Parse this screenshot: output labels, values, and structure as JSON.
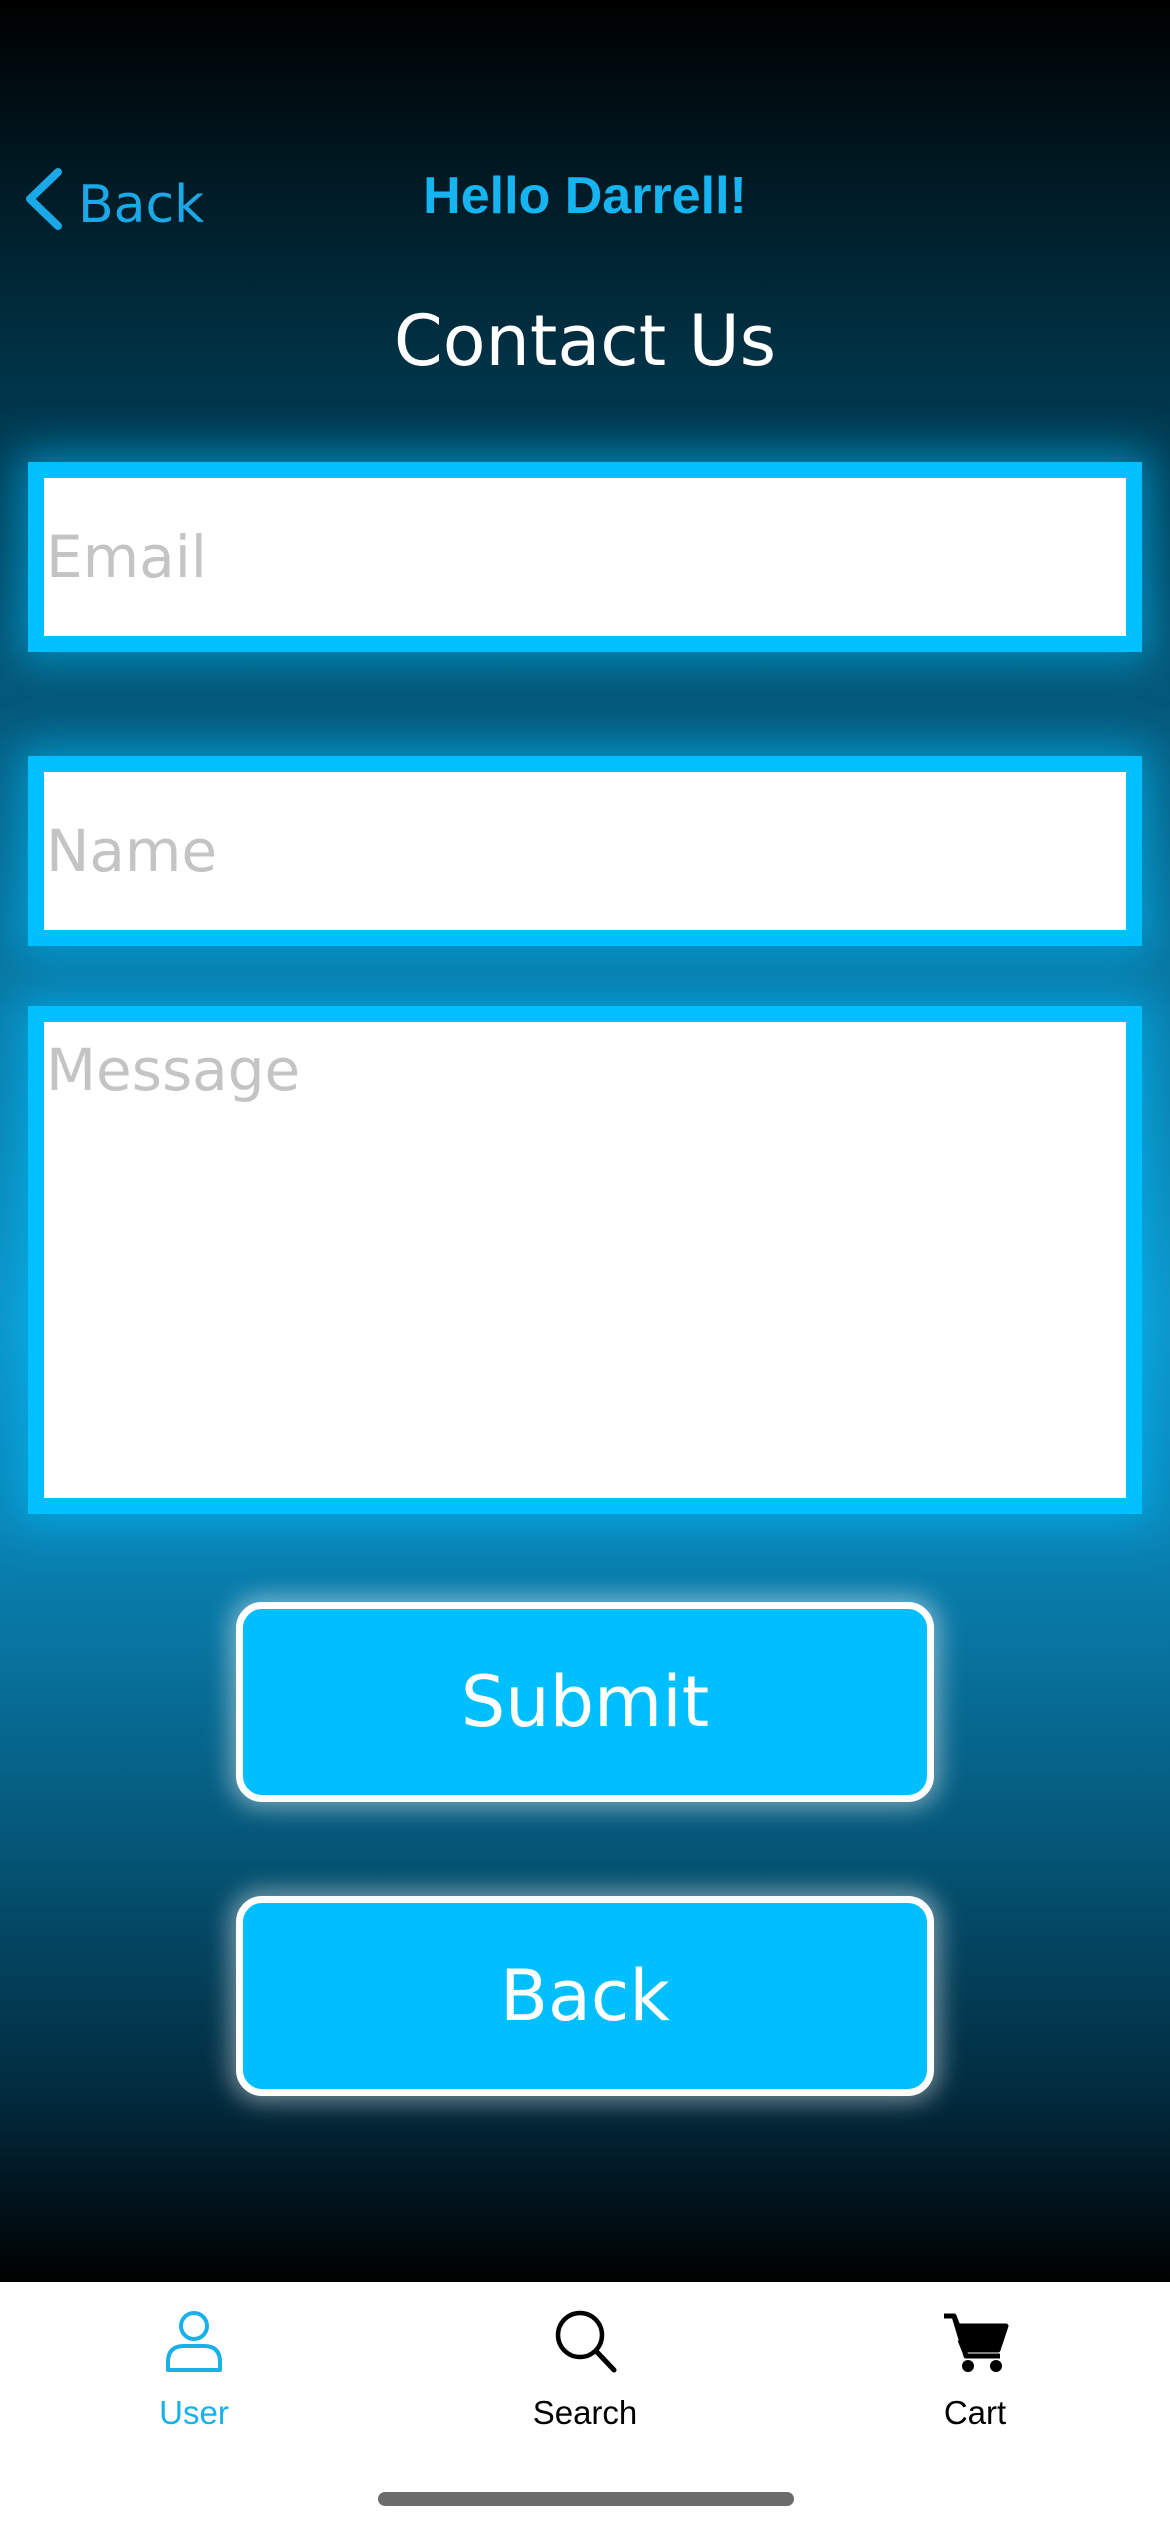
{
  "nav": {
    "back_label": "Back",
    "greeting": "Hello Darrell!"
  },
  "page": {
    "title": "Contact Us"
  },
  "form": {
    "email_placeholder": "Email",
    "email_value": "",
    "name_placeholder": "Name",
    "name_value": "",
    "message_placeholder": "Message",
    "message_value": "",
    "submit_label": "Submit",
    "back_label": "Back"
  },
  "tabbar": {
    "items": [
      {
        "label": "User",
        "icon": "user-icon",
        "active": true
      },
      {
        "label": "Search",
        "icon": "search-icon",
        "active": false
      },
      {
        "label": "Cart",
        "icon": "cart-icon",
        "active": false
      }
    ]
  },
  "colors": {
    "accent": "#00bfff",
    "nav_text": "#16b4f0",
    "active_tab": "#1ab0ea",
    "background_dark": "#000000"
  }
}
